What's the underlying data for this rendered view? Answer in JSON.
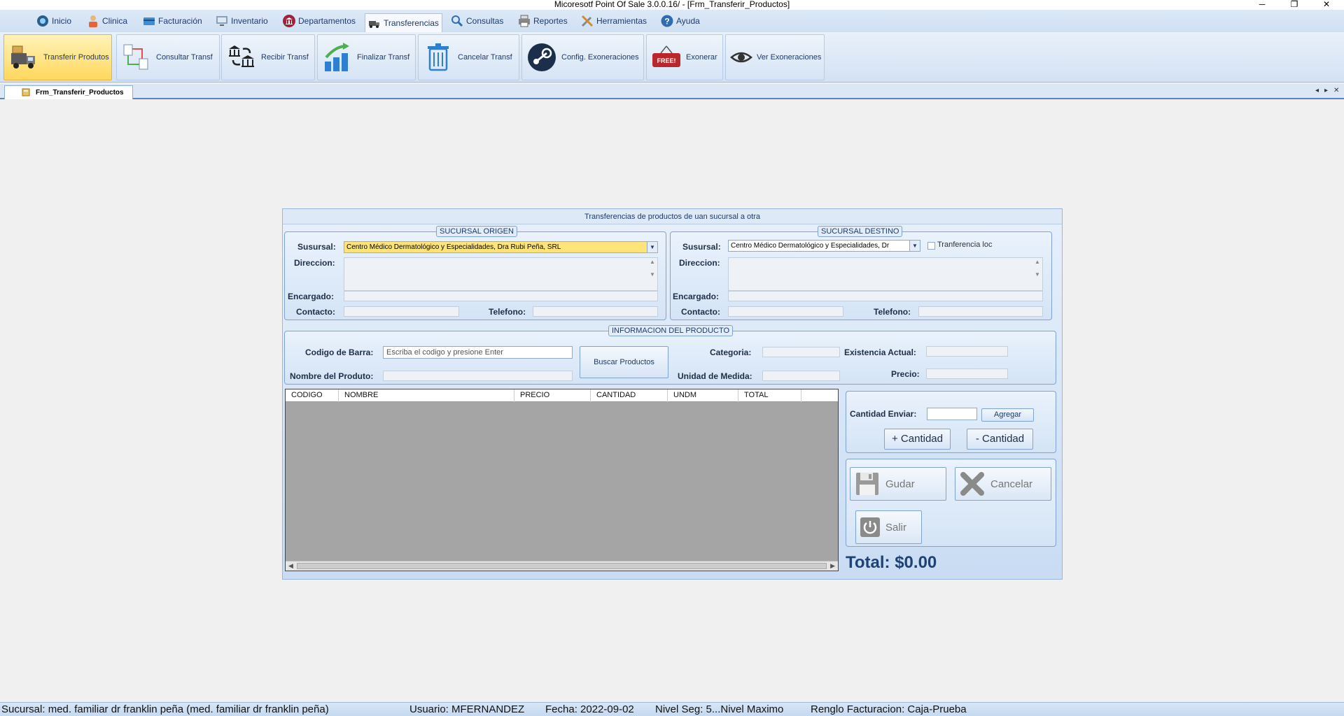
{
  "window": {
    "title": "Micoresotf Point Of Sale 3.0.0.16/ - [Frm_Transferir_Productos]",
    "minimize": "─",
    "restore": "❐",
    "close": "✕"
  },
  "menu": {
    "items": [
      {
        "label": "Inicio",
        "icon": "home-icon"
      },
      {
        "label": "Clinica",
        "icon": "doctor-icon"
      },
      {
        "label": "Facturación",
        "icon": "card-icon"
      },
      {
        "label": "Inventario",
        "icon": "monitor-icon"
      },
      {
        "label": "Departamentos",
        "icon": "bank-icon"
      },
      {
        "label": "Transferencias",
        "icon": "transfer-icon"
      },
      {
        "label": "Consultas",
        "icon": "search-icon"
      },
      {
        "label": "Reportes",
        "icon": "printer-icon"
      },
      {
        "label": "Herramientas",
        "icon": "tools-icon"
      },
      {
        "label": "Ayuda",
        "icon": "help-icon"
      }
    ]
  },
  "ribbon": {
    "buttons": [
      {
        "label": "Transferir Produtos",
        "icon": "truck-icon"
      },
      {
        "label": "Consultar Transf",
        "icon": "documents-link-icon"
      },
      {
        "label": "Recibir Transf",
        "icon": "bank-exchange-icon"
      },
      {
        "label": "Finalizar Transf",
        "icon": "growth-chart-icon"
      },
      {
        "label": "Cancelar Transf",
        "icon": "trash-icon"
      },
      {
        "label": "Config. Exoneraciones",
        "icon": "steam-icon"
      },
      {
        "label": "Exonerar",
        "icon": "free-tag-icon",
        "tag_text": "FREE!"
      },
      {
        "label": "Ver Exoneraciones",
        "icon": "eye-icon"
      }
    ]
  },
  "tabs": {
    "document_tab": "Frm_Transferir_Productos",
    "nav_left": "◂",
    "nav_right": "▸",
    "nav_close": "✕"
  },
  "form": {
    "title": "Transferencias de productos de uan sucursal a otra",
    "origin": {
      "legend": "SUCURSAL ORIGEN",
      "sucursal_label": "Susursal:",
      "sucursal_value": "Centro Médico Dermatológico y Especialidades, Dra Rubi Peña, SRL",
      "direccion_label": "Direccion:",
      "encargado_label": "Encargado:",
      "contacto_label": "Contacto:",
      "telefono_label": "Telefono:"
    },
    "destination": {
      "legend": "SUCURSAL  DESTINO",
      "sucursal_label": "Susursal:",
      "sucursal_value": "Centro Médico Dermatológico y Especialidades, Dr",
      "local_transfer_label": "Tranferencia loc",
      "direccion_label": "Direccion:",
      "encargado_label": "Encargado:",
      "contacto_label": "Contacto:",
      "telefono_label": "Telefono:"
    },
    "product": {
      "legend": "INFORMACION DEL PRODUCTO",
      "barcode_label": "Codigo de Barra:",
      "barcode_placeholder": "Escriba el codigo y presione Enter",
      "search_button": "Buscar Productos",
      "name_label": "Nombre del Produto:",
      "category_label": "Categoria:",
      "unit_label": "Unidad de Medida:",
      "stock_label": "Existencia Actual:",
      "price_label": "Precio:"
    },
    "grid": {
      "columns": [
        "CODIGO",
        "NOMBRE",
        "PRECIO",
        "CANTIDAD",
        "UNDM",
        "TOTAL"
      ]
    },
    "quantity": {
      "label": "Cantidad Enviar:",
      "add_button": "Agregar",
      "plus_button": "+ Cantidad",
      "minus_button": "- Cantidad"
    },
    "actions": {
      "save": "Gudar",
      "cancel": "Cancelar",
      "exit": "Salir"
    },
    "total": "Total: $0.00"
  },
  "status": {
    "sucursal": "Sucursal: med. familiar dr franklin peña (med. familiar dr franklin peña)",
    "usuario": "Usuario: MFERNANDEZ",
    "fecha": "Fecha: 2022-09-02",
    "nivel": "Nivel Seg: 5...Nivel Maximo",
    "renglo": "Renglo Facturacion: Caja-Prueba"
  },
  "colors": {
    "ribbon_active": "#ffd75e",
    "form_accent": "#1f4275",
    "highlight_combo": "#ffe47a"
  }
}
